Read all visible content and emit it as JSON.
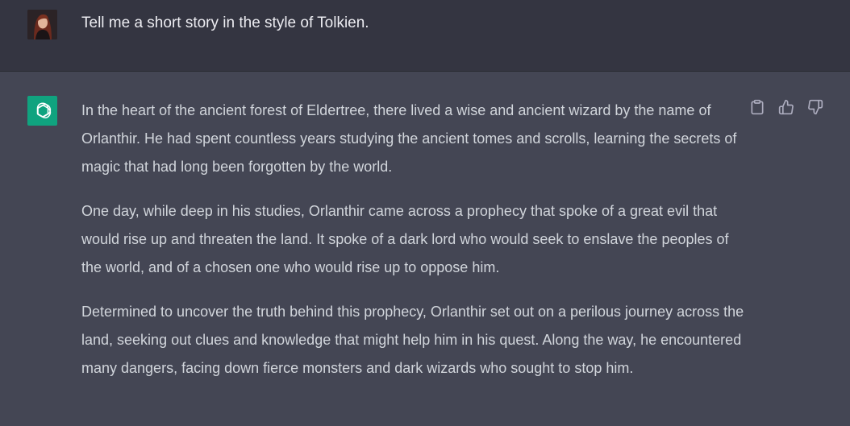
{
  "user_message": {
    "text": "Tell me a short story in the style of Tolkien."
  },
  "assistant_message": {
    "paragraphs": [
      "In the heart of the ancient forest of Eldertree, there lived a wise and ancient wizard by the name of Orlanthir. He had spent countless years studying the ancient tomes and scrolls, learning the secrets of magic that had long been forgotten by the world.",
      "One day, while deep in his studies, Orlanthir came across a prophecy that spoke of a great evil that would rise up and threaten the land. It spoke of a dark lord who would seek to enslave the peoples of the world, and of a chosen one who would rise up to oppose him.",
      "Determined to uncover the truth behind this prophecy, Orlanthir set out on a perilous journey across the land, seeking out clues and knowledge that might help him in his quest. Along the way, he encountered many dangers, facing down fierce monsters and dark wizards who sought to stop him."
    ]
  },
  "icons": {
    "copy": "clipboard-icon",
    "like": "thumbs-up-icon",
    "dislike": "thumbs-down-icon",
    "assistant_logo": "openai-logo-icon"
  },
  "colors": {
    "user_row_bg": "#343541",
    "assistant_row_bg": "#444654",
    "accent": "#10a37f"
  }
}
